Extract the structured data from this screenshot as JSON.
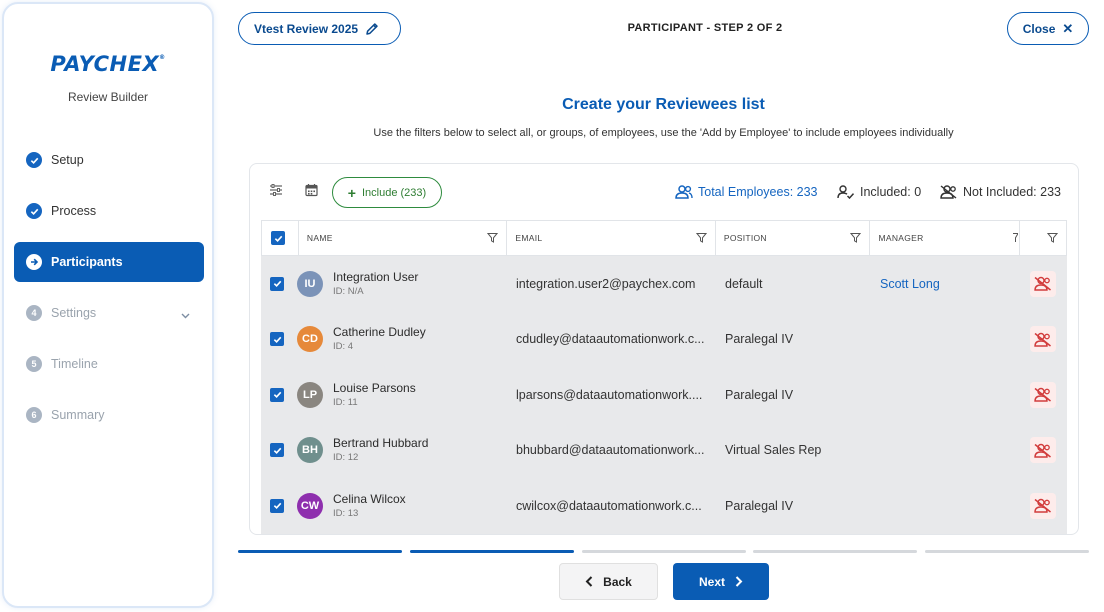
{
  "sidebar": {
    "logo": "PAYCHEX",
    "logo_mark": "®",
    "subtitle": "Review Builder",
    "items": [
      {
        "label": "Setup",
        "state": "done",
        "number": ""
      },
      {
        "label": "Process",
        "state": "done",
        "number": ""
      },
      {
        "label": "Participants",
        "state": "active",
        "number": ""
      },
      {
        "label": "Settings",
        "state": "todo",
        "number": "4"
      },
      {
        "label": "Timeline",
        "state": "todo",
        "number": "5"
      },
      {
        "label": "Summary",
        "state": "todo",
        "number": "6"
      }
    ]
  },
  "header": {
    "review_name": "Vtest Review 2025",
    "step_title": "PARTICIPANT - STEP 2 OF 2",
    "close_label": "Close",
    "close_symbol": "✕"
  },
  "main": {
    "title": "Create your Reviewees list",
    "description": "Use the filters below to select all, or groups, of employees, use the 'Add by Employee' to include employees individually"
  },
  "toolbar": {
    "include_label": "Include (233)",
    "total_label": "Total Employees: 233",
    "included_label": "Included: 0",
    "not_included_label": "Not Included: 233"
  },
  "table": {
    "columns": [
      "NAME",
      "EMAIL",
      "POSITION",
      "MANAGER"
    ],
    "rows": [
      {
        "initials": "IU",
        "name": "Integration User",
        "id": "ID: N/A",
        "email": "integration.user2@paychex.com",
        "position": "default",
        "manager": "Scott Long",
        "avatar_color": "#7b93b8"
      },
      {
        "initials": "CD",
        "name": "Catherine Dudley",
        "id": "ID: 4",
        "email": "cdudley@dataautomationwork.c...",
        "position": "Paralegal IV",
        "manager": "",
        "avatar_color": "#e6893a"
      },
      {
        "initials": "LP",
        "name": "Louise Parsons",
        "id": "ID: 11",
        "email": "lparsons@dataautomationwork....",
        "position": "Paralegal IV",
        "manager": "",
        "avatar_color": "#8a8680"
      },
      {
        "initials": "BH",
        "name": "Bertrand Hubbard",
        "id": "ID: 12",
        "email": "bhubbard@dataautomationwork...",
        "position": "Virtual Sales Rep",
        "manager": "",
        "avatar_color": "#6f8f8d"
      },
      {
        "initials": "CW",
        "name": "Celina Wilcox",
        "id": "ID: 13",
        "email": "cwilcox@dataautomationwork.c...",
        "position": "Paralegal IV",
        "manager": "",
        "avatar_color": "#8e2fae"
      }
    ]
  },
  "progress": {
    "total_steps": 5,
    "completed_steps": 2
  },
  "footer": {
    "back_label": "Back",
    "next_label": "Next"
  },
  "colors": {
    "brand": "#0a5cb4",
    "include_green": "#2e7d32",
    "exclude_red": "#d23c3c"
  }
}
